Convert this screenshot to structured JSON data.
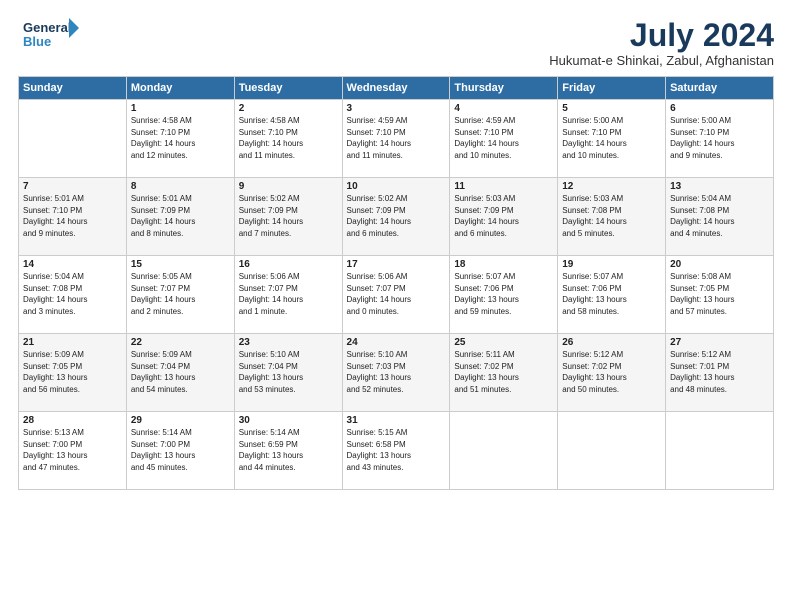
{
  "header": {
    "logo_line1": "General",
    "logo_line2": "Blue",
    "month": "July 2024",
    "location": "Hukumat-e Shinkai, Zabul, Afghanistan"
  },
  "days_of_week": [
    "Sunday",
    "Monday",
    "Tuesday",
    "Wednesday",
    "Thursday",
    "Friday",
    "Saturday"
  ],
  "weeks": [
    [
      {
        "day": "",
        "info": ""
      },
      {
        "day": "1",
        "info": "Sunrise: 4:58 AM\nSunset: 7:10 PM\nDaylight: 14 hours\nand 12 minutes."
      },
      {
        "day": "2",
        "info": "Sunrise: 4:58 AM\nSunset: 7:10 PM\nDaylight: 14 hours\nand 11 minutes."
      },
      {
        "day": "3",
        "info": "Sunrise: 4:59 AM\nSunset: 7:10 PM\nDaylight: 14 hours\nand 11 minutes."
      },
      {
        "day": "4",
        "info": "Sunrise: 4:59 AM\nSunset: 7:10 PM\nDaylight: 14 hours\nand 10 minutes."
      },
      {
        "day": "5",
        "info": "Sunrise: 5:00 AM\nSunset: 7:10 PM\nDaylight: 14 hours\nand 10 minutes."
      },
      {
        "day": "6",
        "info": "Sunrise: 5:00 AM\nSunset: 7:10 PM\nDaylight: 14 hours\nand 9 minutes."
      }
    ],
    [
      {
        "day": "7",
        "info": "Sunrise: 5:01 AM\nSunset: 7:10 PM\nDaylight: 14 hours\nand 9 minutes."
      },
      {
        "day": "8",
        "info": "Sunrise: 5:01 AM\nSunset: 7:09 PM\nDaylight: 14 hours\nand 8 minutes."
      },
      {
        "day": "9",
        "info": "Sunrise: 5:02 AM\nSunset: 7:09 PM\nDaylight: 14 hours\nand 7 minutes."
      },
      {
        "day": "10",
        "info": "Sunrise: 5:02 AM\nSunset: 7:09 PM\nDaylight: 14 hours\nand 6 minutes."
      },
      {
        "day": "11",
        "info": "Sunrise: 5:03 AM\nSunset: 7:09 PM\nDaylight: 14 hours\nand 6 minutes."
      },
      {
        "day": "12",
        "info": "Sunrise: 5:03 AM\nSunset: 7:08 PM\nDaylight: 14 hours\nand 5 minutes."
      },
      {
        "day": "13",
        "info": "Sunrise: 5:04 AM\nSunset: 7:08 PM\nDaylight: 14 hours\nand 4 minutes."
      }
    ],
    [
      {
        "day": "14",
        "info": "Sunrise: 5:04 AM\nSunset: 7:08 PM\nDaylight: 14 hours\nand 3 minutes."
      },
      {
        "day": "15",
        "info": "Sunrise: 5:05 AM\nSunset: 7:07 PM\nDaylight: 14 hours\nand 2 minutes."
      },
      {
        "day": "16",
        "info": "Sunrise: 5:06 AM\nSunset: 7:07 PM\nDaylight: 14 hours\nand 1 minute."
      },
      {
        "day": "17",
        "info": "Sunrise: 5:06 AM\nSunset: 7:07 PM\nDaylight: 14 hours\nand 0 minutes."
      },
      {
        "day": "18",
        "info": "Sunrise: 5:07 AM\nSunset: 7:06 PM\nDaylight: 13 hours\nand 59 minutes."
      },
      {
        "day": "19",
        "info": "Sunrise: 5:07 AM\nSunset: 7:06 PM\nDaylight: 13 hours\nand 58 minutes."
      },
      {
        "day": "20",
        "info": "Sunrise: 5:08 AM\nSunset: 7:05 PM\nDaylight: 13 hours\nand 57 minutes."
      }
    ],
    [
      {
        "day": "21",
        "info": "Sunrise: 5:09 AM\nSunset: 7:05 PM\nDaylight: 13 hours\nand 56 minutes."
      },
      {
        "day": "22",
        "info": "Sunrise: 5:09 AM\nSunset: 7:04 PM\nDaylight: 13 hours\nand 54 minutes."
      },
      {
        "day": "23",
        "info": "Sunrise: 5:10 AM\nSunset: 7:04 PM\nDaylight: 13 hours\nand 53 minutes."
      },
      {
        "day": "24",
        "info": "Sunrise: 5:10 AM\nSunset: 7:03 PM\nDaylight: 13 hours\nand 52 minutes."
      },
      {
        "day": "25",
        "info": "Sunrise: 5:11 AM\nSunset: 7:02 PM\nDaylight: 13 hours\nand 51 minutes."
      },
      {
        "day": "26",
        "info": "Sunrise: 5:12 AM\nSunset: 7:02 PM\nDaylight: 13 hours\nand 50 minutes."
      },
      {
        "day": "27",
        "info": "Sunrise: 5:12 AM\nSunset: 7:01 PM\nDaylight: 13 hours\nand 48 minutes."
      }
    ],
    [
      {
        "day": "28",
        "info": "Sunrise: 5:13 AM\nSunset: 7:00 PM\nDaylight: 13 hours\nand 47 minutes."
      },
      {
        "day": "29",
        "info": "Sunrise: 5:14 AM\nSunset: 7:00 PM\nDaylight: 13 hours\nand 45 minutes."
      },
      {
        "day": "30",
        "info": "Sunrise: 5:14 AM\nSunset: 6:59 PM\nDaylight: 13 hours\nand 44 minutes."
      },
      {
        "day": "31",
        "info": "Sunrise: 5:15 AM\nSunset: 6:58 PM\nDaylight: 13 hours\nand 43 minutes."
      },
      {
        "day": "",
        "info": ""
      },
      {
        "day": "",
        "info": ""
      },
      {
        "day": "",
        "info": ""
      }
    ]
  ]
}
